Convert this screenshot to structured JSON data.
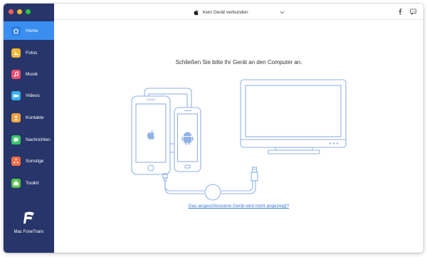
{
  "app": {
    "name": "Mac FoneTrans",
    "traffic_lights": [
      "#fe5f57",
      "#febc2e",
      "#28c840"
    ]
  },
  "colors": {
    "sidebar_bg": "#27356a",
    "active_item": "#3a8ef0",
    "illustration_stroke": "#8fb2e6",
    "link": "#3a7bd5"
  },
  "sidebar": {
    "items": [
      {
        "label": "Home",
        "icon": "home-icon",
        "color": "#3a8ef0",
        "active": true
      },
      {
        "label": "Fotos",
        "icon": "photos-icon",
        "color": "#f5b632",
        "active": false
      },
      {
        "label": "Musik",
        "icon": "music-icon",
        "color": "#f0506e",
        "active": false
      },
      {
        "label": "Videos",
        "icon": "video-icon",
        "color": "#3ab0f0",
        "active": false
      },
      {
        "label": "Kontakte",
        "icon": "contacts-icon",
        "color": "#f2a03d",
        "active": false
      },
      {
        "label": "Nachrichten",
        "icon": "messages-icon",
        "color": "#3dc46a",
        "active": false
      },
      {
        "label": "Sonstige",
        "icon": "other-icon",
        "color": "#f46a45",
        "active": false
      },
      {
        "label": "Toolkit",
        "icon": "toolkit-icon",
        "color": "#56c24a",
        "active": false
      }
    ]
  },
  "topbar": {
    "device_label": "Kein Gerät verbunden",
    "facebook_icon": "facebook-icon",
    "feedback_icon": "chat-icon"
  },
  "main": {
    "heading": "Schließen Sie bitte Ihr Gerät an den Computer an.",
    "help_link": "Das angeschlossene Gerät wird nicht angezeigt?"
  }
}
